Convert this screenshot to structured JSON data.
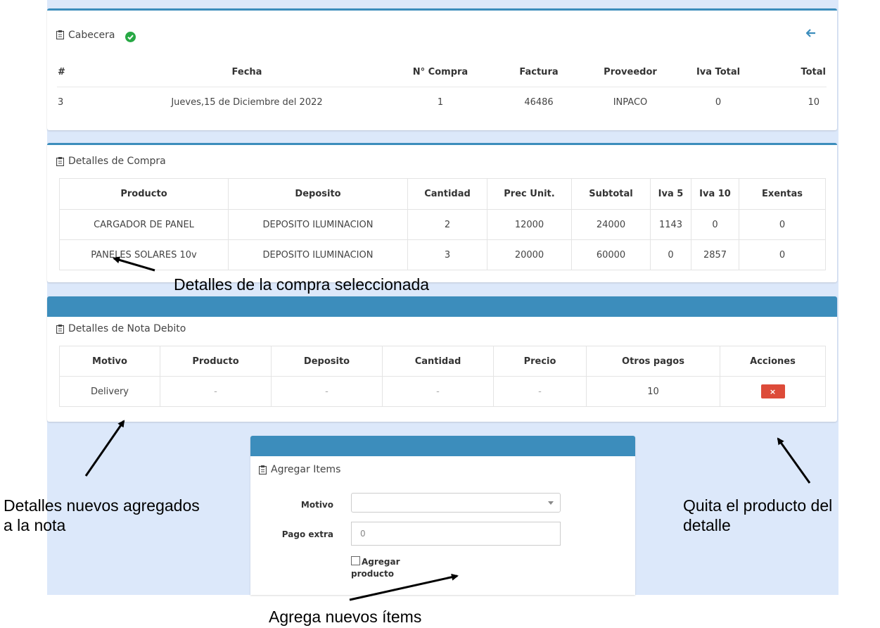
{
  "cabecera": {
    "title": "Cabecera",
    "headers": [
      "#",
      "Fecha",
      "N° Compra",
      "Factura",
      "Proveedor",
      "Iva Total",
      "Total"
    ],
    "row": [
      "3",
      "Jueves,15 de Diciembre del 2022",
      "1",
      "46486",
      "INPACO",
      "0",
      "10"
    ]
  },
  "detalles_compra": {
    "title": "Detalles de Compra",
    "headers": [
      "Producto",
      "Deposito",
      "Cantidad",
      "Prec Unit.",
      "Subtotal",
      "Iva 5",
      "Iva 10",
      "Exentas"
    ],
    "rows": [
      [
        "CARGADOR DE PANEL",
        "DEPOSITO ILUMINACION",
        "2",
        "12000",
        "24000",
        "1143",
        "0",
        "0"
      ],
      [
        "PANELES SOLARES 10v",
        "DEPOSITO ILUMINACION",
        "3",
        "20000",
        "60000",
        "0",
        "2857",
        "0"
      ]
    ]
  },
  "detalles_nota": {
    "title": "Detalles de Nota Debito",
    "headers": [
      "Motivo",
      "Producto",
      "Deposito",
      "Cantidad",
      "Precio",
      "Otros pagos",
      "Acciones"
    ],
    "row": [
      "Delivery",
      "-",
      "-",
      "-",
      "-",
      "10"
    ],
    "delete_label": "×"
  },
  "agregar": {
    "title": "Agregar Items",
    "motivo_label": "Motivo",
    "motivo_value": "",
    "pago_label": "Pago extra",
    "pago_value": "0",
    "checkbox_label_1": "Agregar",
    "checkbox_label_2": "producto"
  },
  "annotations": {
    "a1": "Detalles de la compra seleccionada",
    "a2_line1": "Detalles nuevos agregados",
    "a2_line2": "a la nota",
    "a3_line1": "Quita el producto del",
    "a3_line2": "detalle",
    "a4": "Agrega nuevos ítems"
  },
  "colors": {
    "primary": "#3c8dbc",
    "danger": "#dd4b39",
    "success": "#27a844",
    "background": "#dce8fa"
  }
}
